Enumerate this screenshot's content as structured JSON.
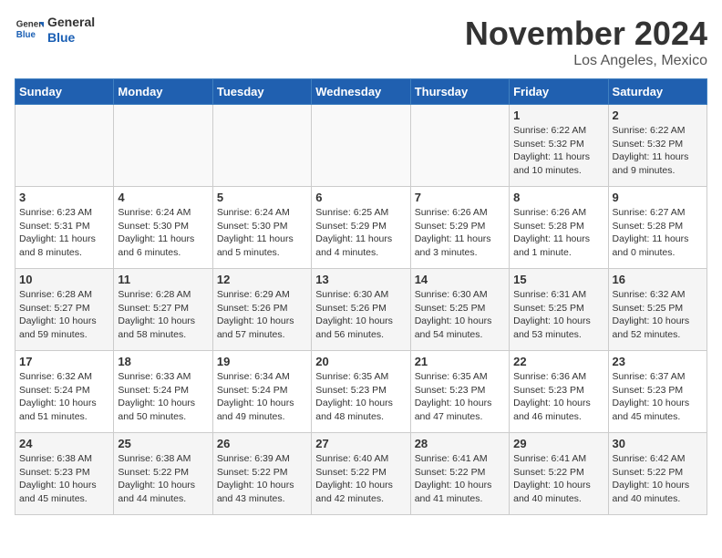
{
  "header": {
    "logo_general": "General",
    "logo_blue": "Blue",
    "month_title": "November 2024",
    "subtitle": "Los Angeles, Mexico"
  },
  "weekdays": [
    "Sunday",
    "Monday",
    "Tuesday",
    "Wednesday",
    "Thursday",
    "Friday",
    "Saturday"
  ],
  "weeks": [
    [
      {
        "day": "",
        "info": ""
      },
      {
        "day": "",
        "info": ""
      },
      {
        "day": "",
        "info": ""
      },
      {
        "day": "",
        "info": ""
      },
      {
        "day": "",
        "info": ""
      },
      {
        "day": "1",
        "info": "Sunrise: 6:22 AM\nSunset: 5:32 PM\nDaylight: 11 hours and 10 minutes."
      },
      {
        "day": "2",
        "info": "Sunrise: 6:22 AM\nSunset: 5:32 PM\nDaylight: 11 hours and 9 minutes."
      }
    ],
    [
      {
        "day": "3",
        "info": "Sunrise: 6:23 AM\nSunset: 5:31 PM\nDaylight: 11 hours and 8 minutes."
      },
      {
        "day": "4",
        "info": "Sunrise: 6:24 AM\nSunset: 5:30 PM\nDaylight: 11 hours and 6 minutes."
      },
      {
        "day": "5",
        "info": "Sunrise: 6:24 AM\nSunset: 5:30 PM\nDaylight: 11 hours and 5 minutes."
      },
      {
        "day": "6",
        "info": "Sunrise: 6:25 AM\nSunset: 5:29 PM\nDaylight: 11 hours and 4 minutes."
      },
      {
        "day": "7",
        "info": "Sunrise: 6:26 AM\nSunset: 5:29 PM\nDaylight: 11 hours and 3 minutes."
      },
      {
        "day": "8",
        "info": "Sunrise: 6:26 AM\nSunset: 5:28 PM\nDaylight: 11 hours and 1 minute."
      },
      {
        "day": "9",
        "info": "Sunrise: 6:27 AM\nSunset: 5:28 PM\nDaylight: 11 hours and 0 minutes."
      }
    ],
    [
      {
        "day": "10",
        "info": "Sunrise: 6:28 AM\nSunset: 5:27 PM\nDaylight: 10 hours and 59 minutes."
      },
      {
        "day": "11",
        "info": "Sunrise: 6:28 AM\nSunset: 5:27 PM\nDaylight: 10 hours and 58 minutes."
      },
      {
        "day": "12",
        "info": "Sunrise: 6:29 AM\nSunset: 5:26 PM\nDaylight: 10 hours and 57 minutes."
      },
      {
        "day": "13",
        "info": "Sunrise: 6:30 AM\nSunset: 5:26 PM\nDaylight: 10 hours and 56 minutes."
      },
      {
        "day": "14",
        "info": "Sunrise: 6:30 AM\nSunset: 5:25 PM\nDaylight: 10 hours and 54 minutes."
      },
      {
        "day": "15",
        "info": "Sunrise: 6:31 AM\nSunset: 5:25 PM\nDaylight: 10 hours and 53 minutes."
      },
      {
        "day": "16",
        "info": "Sunrise: 6:32 AM\nSunset: 5:25 PM\nDaylight: 10 hours and 52 minutes."
      }
    ],
    [
      {
        "day": "17",
        "info": "Sunrise: 6:32 AM\nSunset: 5:24 PM\nDaylight: 10 hours and 51 minutes."
      },
      {
        "day": "18",
        "info": "Sunrise: 6:33 AM\nSunset: 5:24 PM\nDaylight: 10 hours and 50 minutes."
      },
      {
        "day": "19",
        "info": "Sunrise: 6:34 AM\nSunset: 5:24 PM\nDaylight: 10 hours and 49 minutes."
      },
      {
        "day": "20",
        "info": "Sunrise: 6:35 AM\nSunset: 5:23 PM\nDaylight: 10 hours and 48 minutes."
      },
      {
        "day": "21",
        "info": "Sunrise: 6:35 AM\nSunset: 5:23 PM\nDaylight: 10 hours and 47 minutes."
      },
      {
        "day": "22",
        "info": "Sunrise: 6:36 AM\nSunset: 5:23 PM\nDaylight: 10 hours and 46 minutes."
      },
      {
        "day": "23",
        "info": "Sunrise: 6:37 AM\nSunset: 5:23 PM\nDaylight: 10 hours and 45 minutes."
      }
    ],
    [
      {
        "day": "24",
        "info": "Sunrise: 6:38 AM\nSunset: 5:23 PM\nDaylight: 10 hours and 45 minutes."
      },
      {
        "day": "25",
        "info": "Sunrise: 6:38 AM\nSunset: 5:22 PM\nDaylight: 10 hours and 44 minutes."
      },
      {
        "day": "26",
        "info": "Sunrise: 6:39 AM\nSunset: 5:22 PM\nDaylight: 10 hours and 43 minutes."
      },
      {
        "day": "27",
        "info": "Sunrise: 6:40 AM\nSunset: 5:22 PM\nDaylight: 10 hours and 42 minutes."
      },
      {
        "day": "28",
        "info": "Sunrise: 6:41 AM\nSunset: 5:22 PM\nDaylight: 10 hours and 41 minutes."
      },
      {
        "day": "29",
        "info": "Sunrise: 6:41 AM\nSunset: 5:22 PM\nDaylight: 10 hours and 40 minutes."
      },
      {
        "day": "30",
        "info": "Sunrise: 6:42 AM\nSunset: 5:22 PM\nDaylight: 10 hours and 40 minutes."
      }
    ]
  ]
}
